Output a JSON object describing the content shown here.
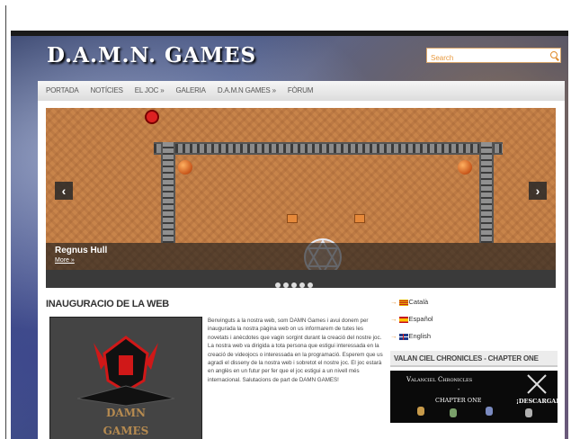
{
  "site": {
    "title": "D.A.M.N. GAMES"
  },
  "search": {
    "placeholder": "Search"
  },
  "nav": {
    "items": [
      "PORTADA",
      "NOTÍCIES",
      "EL JOC »",
      "GALERIA",
      "D.A.M.N GAMES »",
      "FÒRUM"
    ]
  },
  "slider": {
    "caption_title": "Regnus Hull",
    "caption_more": "More »",
    "prev": "‹",
    "next": "›",
    "dots": 5
  },
  "post": {
    "title": "INAUGURACIO DE LA WEB",
    "logo_text_1": "DAMN",
    "logo_text_2": "GAMES",
    "body": "Benvinguts a la nostra web, som DAMN Games i avui donem per inaugurada la nostra pàgina web on us informarem de tutes les novetats i anècdotes que vagin sorgint durant la creació del nostre joc. La nostra web va dirigida a tota persona que estigui interessada en la creació de videojocs o interessada en la programació. Esperem que us agradi el disseny de la nostra web i sobretot el nostre joc. El joc estarà en anglès en un futur per fer que el joc estigui a un nivell més internacional. Salutacions de part de DAMN GAMES!"
  },
  "languages": [
    {
      "label": "Català",
      "flag": "catalonia-flag-icon"
    },
    {
      "label": "Español",
      "flag": "spain-flag-icon"
    },
    {
      "label": "English",
      "flag": "uk-flag-icon"
    }
  ],
  "widget": {
    "title": "VALAN CIEL CHRONICLES - CHAPTER ONE",
    "banner_title": "Valanciel Chronicles",
    "banner_dash": "-",
    "banner_chapter": "CHAPTER ONE",
    "banner_cta": "¡DESCARGAR!"
  },
  "colors": {
    "accent": "#e08a2a",
    "nav_bg": "#e6e6e6",
    "page_bg": "#2a3b6c"
  }
}
